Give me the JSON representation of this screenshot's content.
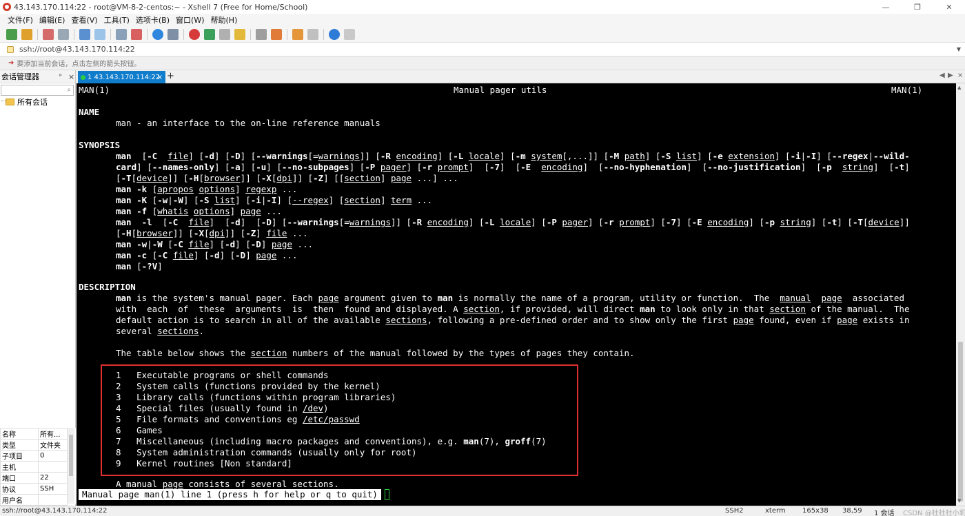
{
  "window": {
    "title": "43.143.170.114:22 - root@VM-8-2-centos:~ - Xshell 7 (Free for Home/School)",
    "controls": [
      "—",
      "❐",
      "✕"
    ]
  },
  "menu": {
    "items": [
      "文件(F)",
      "编辑(E)",
      "查看(V)",
      "工具(T)",
      "选项卡(B)",
      "窗口(W)",
      "帮助(H)"
    ]
  },
  "address": {
    "value": "ssh://root@43.143.170.114:22"
  },
  "hint": {
    "text": "要添加当前会话，点击左侧的箭头按钮。"
  },
  "sidebar": {
    "title": "会话管理器",
    "pin": "ᵖ",
    "close": "×",
    "tree_label": "所有会话",
    "properties": [
      {
        "k": "名称",
        "v": "所有..."
      },
      {
        "k": "类型",
        "v": "文件夹"
      },
      {
        "k": "子项目",
        "v": "0"
      },
      {
        "k": "主机",
        "v": ""
      },
      {
        "k": "端口",
        "v": "22"
      },
      {
        "k": "协议",
        "v": "SSH"
      },
      {
        "k": "用户名",
        "v": ""
      }
    ]
  },
  "tabs": {
    "active_label": "1 43.143.170.114:22",
    "close": "×",
    "add": "+",
    "nav_left": "◀",
    "nav_right": "▶",
    "nav_close": "×"
  },
  "terminal": {
    "header_left": "MAN(1)",
    "header_center": "Manual pager utils",
    "header_right": "MAN(1)",
    "name_heading": "NAME",
    "name_line": "man - an interface to the on-line reference manuals",
    "synopsis_heading": "SYNOPSIS",
    "description_heading": "DESCRIPTION",
    "table_intro_pre": "The table below shows the ",
    "table_intro_link": "section",
    "table_intro_post": " numbers of the manual followed by the types of pages they contain.",
    "sections": [
      {
        "num": "1",
        "text": "Executable programs or shell commands"
      },
      {
        "num": "2",
        "text": "System calls (functions provided by the kernel)"
      },
      {
        "num": "3",
        "text": "Library calls (functions within program libraries)"
      },
      {
        "num": "4",
        "text": "Special files (usually found in /dev)"
      },
      {
        "num": "5",
        "text": "File formats and conventions eg /etc/passwd"
      },
      {
        "num": "6",
        "text": "Games"
      },
      {
        "num": "7",
        "text": "Miscellaneous (including macro packages and conventions), e.g. man(7), groff(7)"
      },
      {
        "num": "8",
        "text": "System administration commands (usually only for root)"
      },
      {
        "num": "9",
        "text": "Kernel routines [Non standard]"
      }
    ],
    "last_line_pre": "A manual ",
    "last_line_link": "page",
    "last_line_post": " consists of several sections.",
    "status": "Manual page man(1) line 1 (press h for help or q to quit)"
  },
  "statusbar": {
    "left": "ssh://root@43.143.170.114:22",
    "protocol": "SSH2",
    "term": "xterm",
    "size": "165x38",
    "pos": "38,59",
    "sessions": "1 会话",
    "watermark": "CSDN @杜杜杜小莉"
  }
}
